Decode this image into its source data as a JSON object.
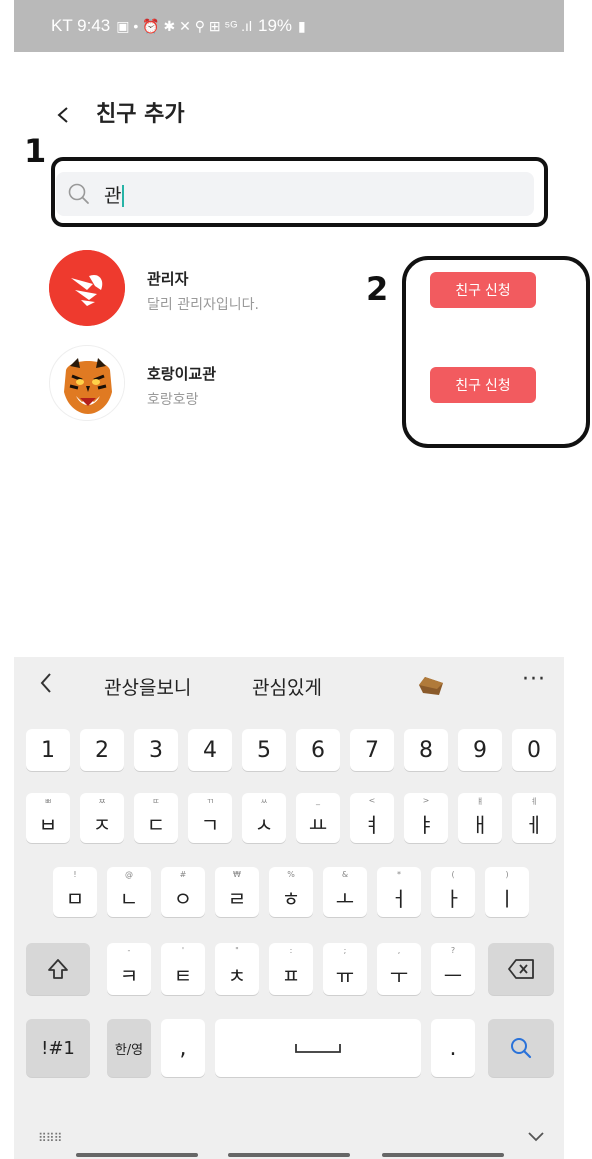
{
  "status_bar": {
    "carrier_time": "KT 9:43",
    "icons_text": "▣ •  ⏰ ✱ ✕ ⚲ ⊞ ⁵ᴳ .ıl 19% ▮",
    "battery": "19%"
  },
  "header": {
    "back_icon": "chevron-left-icon",
    "title": "친구 추가"
  },
  "annotations": {
    "label_1": "1",
    "label_2": "2"
  },
  "search": {
    "icon": "search-icon",
    "value": "관",
    "placeholder": ""
  },
  "friends": [
    {
      "name": "관리자",
      "subtitle": "달리 관리자입니다.",
      "button": "친구 신청",
      "avatar": "dalli-logo-avatar",
      "avatar_color": "#ee3a2e"
    },
    {
      "name": "호랑이교관",
      "subtitle": "호랑호랑",
      "button": "친구 신청",
      "avatar": "tiger-avatar"
    }
  ],
  "keyboard": {
    "suggestions": [
      "관상을보니",
      "관심있게"
    ],
    "suggestion_emoji": "coffin-emoji",
    "more": "···",
    "number_row": [
      "1",
      "2",
      "3",
      "4",
      "5",
      "6",
      "7",
      "8",
      "9",
      "0"
    ],
    "row1": [
      {
        "main": "ㅂ",
        "hint": "ㅃ"
      },
      {
        "main": "ㅈ",
        "hint": "ㅉ"
      },
      {
        "main": "ㄷ",
        "hint": "ㄸ"
      },
      {
        "main": "ㄱ",
        "hint": "ㄲ"
      },
      {
        "main": "ㅅ",
        "hint": "ㅆ"
      },
      {
        "main": "ㅛ",
        "hint": "_"
      },
      {
        "main": "ㅕ",
        "hint": "<"
      },
      {
        "main": "ㅑ",
        "hint": ">"
      },
      {
        "main": "ㅐ",
        "hint": "ㅒ"
      },
      {
        "main": "ㅔ",
        "hint": "ㅖ"
      }
    ],
    "row2": [
      {
        "main": "ㅁ",
        "hint": "!"
      },
      {
        "main": "ㄴ",
        "hint": "@"
      },
      {
        "main": "ㅇ",
        "hint": "#"
      },
      {
        "main": "ㄹ",
        "hint": "₩"
      },
      {
        "main": "ㅎ",
        "hint": "%"
      },
      {
        "main": "ㅗ",
        "hint": "&"
      },
      {
        "main": "ㅓ",
        "hint": "*"
      },
      {
        "main": "ㅏ",
        "hint": "("
      },
      {
        "main": "ㅣ",
        "hint": ")"
      }
    ],
    "row3": [
      {
        "main": "ㅋ",
        "hint": "-"
      },
      {
        "main": "ㅌ",
        "hint": "'"
      },
      {
        "main": "ㅊ",
        "hint": "\""
      },
      {
        "main": "ㅍ",
        "hint": ":"
      },
      {
        "main": "ㅠ",
        "hint": ";"
      },
      {
        "main": "ㅜ",
        "hint": ","
      },
      {
        "main": "ㅡ",
        "hint": "?"
      }
    ],
    "shift_icon": "shift-icon",
    "backspace_icon": "backspace-icon",
    "symbols_key": "!#1",
    "lang_key": "한/영",
    "comma_key": ",",
    "space_icon": "space-icon",
    "period_key": ".",
    "search_key_icon": "search-icon",
    "grid_icon": "keyboard-grid-icon",
    "hide_icon": "chevron-down-icon"
  }
}
